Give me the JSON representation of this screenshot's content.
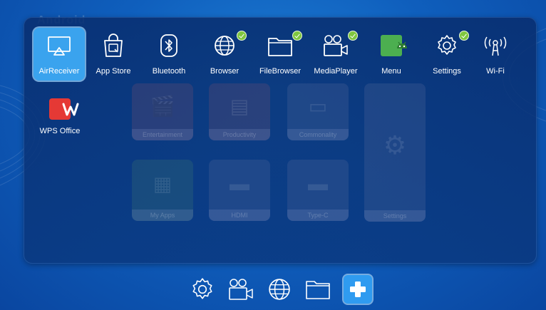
{
  "brand": "Android",
  "apps": [
    {
      "label": "AirReceiver",
      "icon": "airplay-icon",
      "selected": true
    },
    {
      "label": "App Store",
      "icon": "app-store-bag-icon"
    },
    {
      "label": "Bluetooth",
      "icon": "bluetooth-icon"
    },
    {
      "label": "Browser",
      "icon": "globe-icon",
      "installed": true
    },
    {
      "label": "FileBrowser",
      "icon": "folder-icon",
      "installed": true
    },
    {
      "label": "MediaPlayer",
      "icon": "video-camera-icon",
      "installed": true
    },
    {
      "label": "Menu",
      "icon": "android-icon"
    },
    {
      "label": "Settings",
      "icon": "gear-icon",
      "installed": true
    },
    {
      "label": "Wi-Fi",
      "icon": "wifi-antenna-icon"
    },
    {
      "label": "WPS Office",
      "icon": "wps-office-icon"
    }
  ],
  "background_tiles": [
    {
      "label": "Entertainment"
    },
    {
      "label": "Productivity"
    },
    {
      "label": "Commonality"
    },
    {
      "label": "My Apps"
    },
    {
      "label": "HDMI"
    },
    {
      "label": "Type-C"
    },
    {
      "label": "Settings"
    }
  ],
  "dock": [
    {
      "name": "settings",
      "icon": "gear-icon"
    },
    {
      "name": "media",
      "icon": "video-camera-icon"
    },
    {
      "name": "browser",
      "icon": "globe-icon"
    },
    {
      "name": "files",
      "icon": "folder-icon"
    },
    {
      "name": "add",
      "icon": "plus-icon"
    }
  ],
  "colors": {
    "accent": "#3aa3ee",
    "check": "#7fc63f",
    "android_green": "#4caf50",
    "wps_red": "#e53935"
  }
}
